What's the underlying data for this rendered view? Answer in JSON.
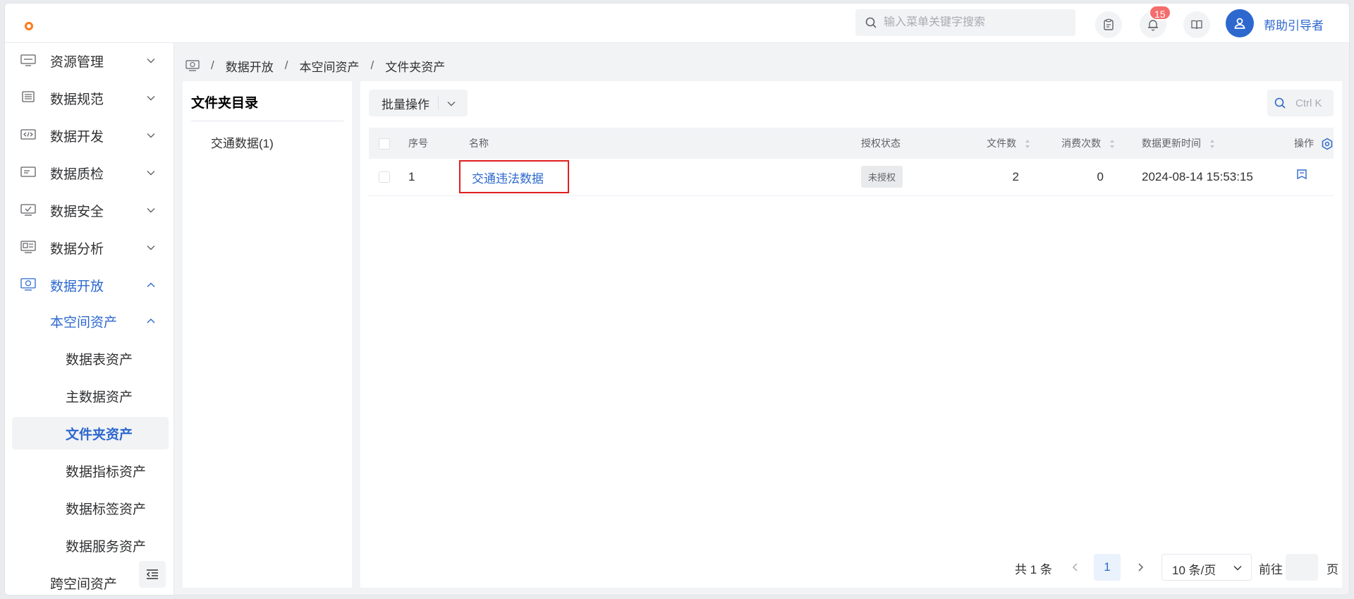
{
  "header": {
    "search_placeholder": "输入菜单关键字搜索",
    "notification_count": "15",
    "username": "帮助引导者"
  },
  "sidebar": {
    "menus": [
      {
        "label": "资源管理",
        "icon": "resource-icon"
      },
      {
        "label": "数据规范",
        "icon": "standard-icon"
      },
      {
        "label": "数据开发",
        "icon": "code-icon"
      },
      {
        "label": "数据质检",
        "icon": "quality-icon"
      },
      {
        "label": "数据安全",
        "icon": "security-icon"
      },
      {
        "label": "数据分析",
        "icon": "analysis-icon"
      },
      {
        "label": "数据开放",
        "icon": "open-data-icon"
      }
    ],
    "submenu": "本空间资产",
    "leaves": [
      "数据表资产",
      "主数据资产",
      "文件夹资产",
      "数据指标资产",
      "数据标签资产",
      "数据服务资产"
    ],
    "next_submenu": "跨空间资产"
  },
  "breadcrumb": [
    "数据开放",
    "本空间资产",
    "文件夹资产"
  ],
  "folder_panel": {
    "title": "文件夹目录",
    "node": "交通数据(1)"
  },
  "toolbar": {
    "batch_label": "批量操作",
    "search_shortcut": "Ctrl K"
  },
  "table": {
    "headers": {
      "index": "序号",
      "name": "名称",
      "status": "授权状态",
      "files": "文件数",
      "consumptions": "消费次数",
      "updated": "数据更新时间",
      "actions": "操作"
    },
    "rows": [
      {
        "index": "1",
        "name": "交通违法数据",
        "status": "未授权",
        "files": "2",
        "consumptions": "0",
        "updated": "2024-08-14 15:53:15"
      }
    ]
  },
  "pagination": {
    "total": "共 1 条",
    "current_page": "1",
    "page_size": "10 条/页",
    "goto_label": "前往",
    "page_suffix": "页"
  },
  "colors": {
    "accent": "#2d68ce",
    "badge": "#f56c6c",
    "highlight_border": "#e01f1f",
    "logo": "#ff7a1a"
  }
}
